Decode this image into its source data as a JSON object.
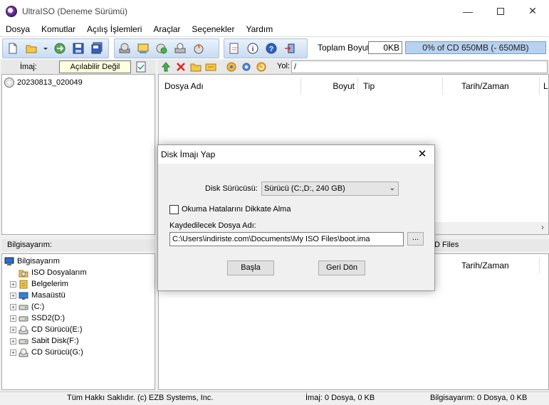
{
  "window": {
    "title": "UltraISO (Deneme Sürümü)",
    "min": "—",
    "close": "✕"
  },
  "menu": [
    "Dosya",
    "Komutlar",
    "Açılış İşlemleri",
    "Araçlar",
    "Seçenekler",
    "Yardım"
  ],
  "toolbar": {
    "size_label": "Toplam Boyut:",
    "size_value": "0KB",
    "capacity_text": "0% of CD 650MB (- 650MB)",
    "capacity_percent": 0,
    "icons": [
      "new-icon",
      "open-icon",
      "dropdown-icon",
      "extract-icon",
      "save-icon",
      "save-as-icon",
      "make-cd-image-icon",
      "make-floppy-image-icon",
      "compress-icon",
      "mount-icon",
      "burn-icon",
      "properties-icon",
      "info-icon",
      "help-icon",
      "exit-icon"
    ]
  },
  "left_header": {
    "label": "İmaj:",
    "value": "Açılabilir Değil"
  },
  "right_header": {
    "path_label": "Yol:",
    "path": "/"
  },
  "image_tree": {
    "root": "20230813_020049"
  },
  "file_columns": {
    "name": "Dosya Adı",
    "size": "Boyut",
    "type": "Tip",
    "date": "Tarih/Zaman",
    "more": "L"
  },
  "hscroll": {
    "arrow": "›"
  },
  "computer_header": "Bilgisayarım:",
  "computer_tree": [
    {
      "label": "Bilgisayarım",
      "icon": "computer-icon",
      "expander": ""
    },
    {
      "label": "ISO Dosyalarım",
      "icon": "iso-folder-icon",
      "expander": ""
    },
    {
      "label": "Belgelerim",
      "icon": "documents-icon",
      "expander": "+"
    },
    {
      "label": "Masaüstü",
      "icon": "desktop-icon",
      "expander": "+"
    },
    {
      "label": "(C:)",
      "icon": "drive-icon",
      "expander": "+"
    },
    {
      "label": "SSD2(D:)",
      "icon": "drive-icon",
      "expander": "+"
    },
    {
      "label": "CD Sürücü(E:)",
      "icon": "cd-drive-icon",
      "expander": "+"
    },
    {
      "label": "Sabit Disk(F:)",
      "icon": "drive-icon",
      "expander": "+"
    },
    {
      "label": "CD Sürücü(G:)",
      "icon": "cd-drive-icon",
      "expander": "+"
    }
  ],
  "lower_right": {
    "header_text": "D Files",
    "date_col": "Tarih/Zaman"
  },
  "status": {
    "copyright": "Tüm Hakkı Saklıdır. (c) EZB Systems, Inc.",
    "image": "İmaj: 0 Dosya, 0 KB",
    "computer": "Bilgisayarım: 0 Dosya, 0 KB"
  },
  "dialog": {
    "title": "Disk İmajı Yap",
    "close": "✕",
    "drive_label": "Disk Sürücüsü:",
    "drive_value": "Sürücü (C:,D:, 240 GB)",
    "ignore_errors_label": "Okuma Hatalarını Dikkate Alma",
    "ignore_errors_checked": false,
    "save_label": "Kaydedilecek Dosya Adı:",
    "save_path": "C:\\Users\\indiriste.com\\Documents\\My ISO Files\\boot.ima",
    "browse_label": "...",
    "start_label": "Başla",
    "back_label": "Geri Dön"
  }
}
